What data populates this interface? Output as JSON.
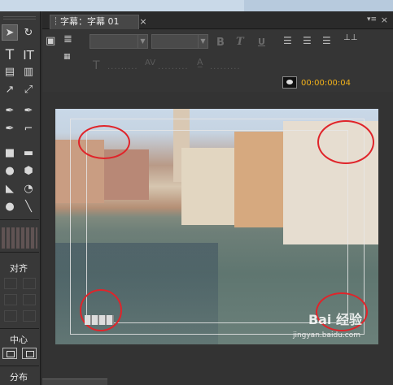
{
  "tab": {
    "title": "字幕：字幕 01",
    "close_glyph": "×"
  },
  "panel": {
    "menu_glyph": "▾≡",
    "close_glyph": "×"
  },
  "toolbar": {
    "bold": "B",
    "italic": "T",
    "underline": "U",
    "timecode": "00:00:00:04",
    "kerning": "AV"
  },
  "tools_panel": {
    "align_label": "对齐",
    "center_label": "中心",
    "distribute_label": "分布"
  },
  "watermark": {
    "brand": "Bai 经验",
    "url": "jingyan.baidu.com"
  },
  "colors": {
    "timecode": "#f2b21a",
    "highlight": "#e0242a",
    "panel": "#333333"
  }
}
